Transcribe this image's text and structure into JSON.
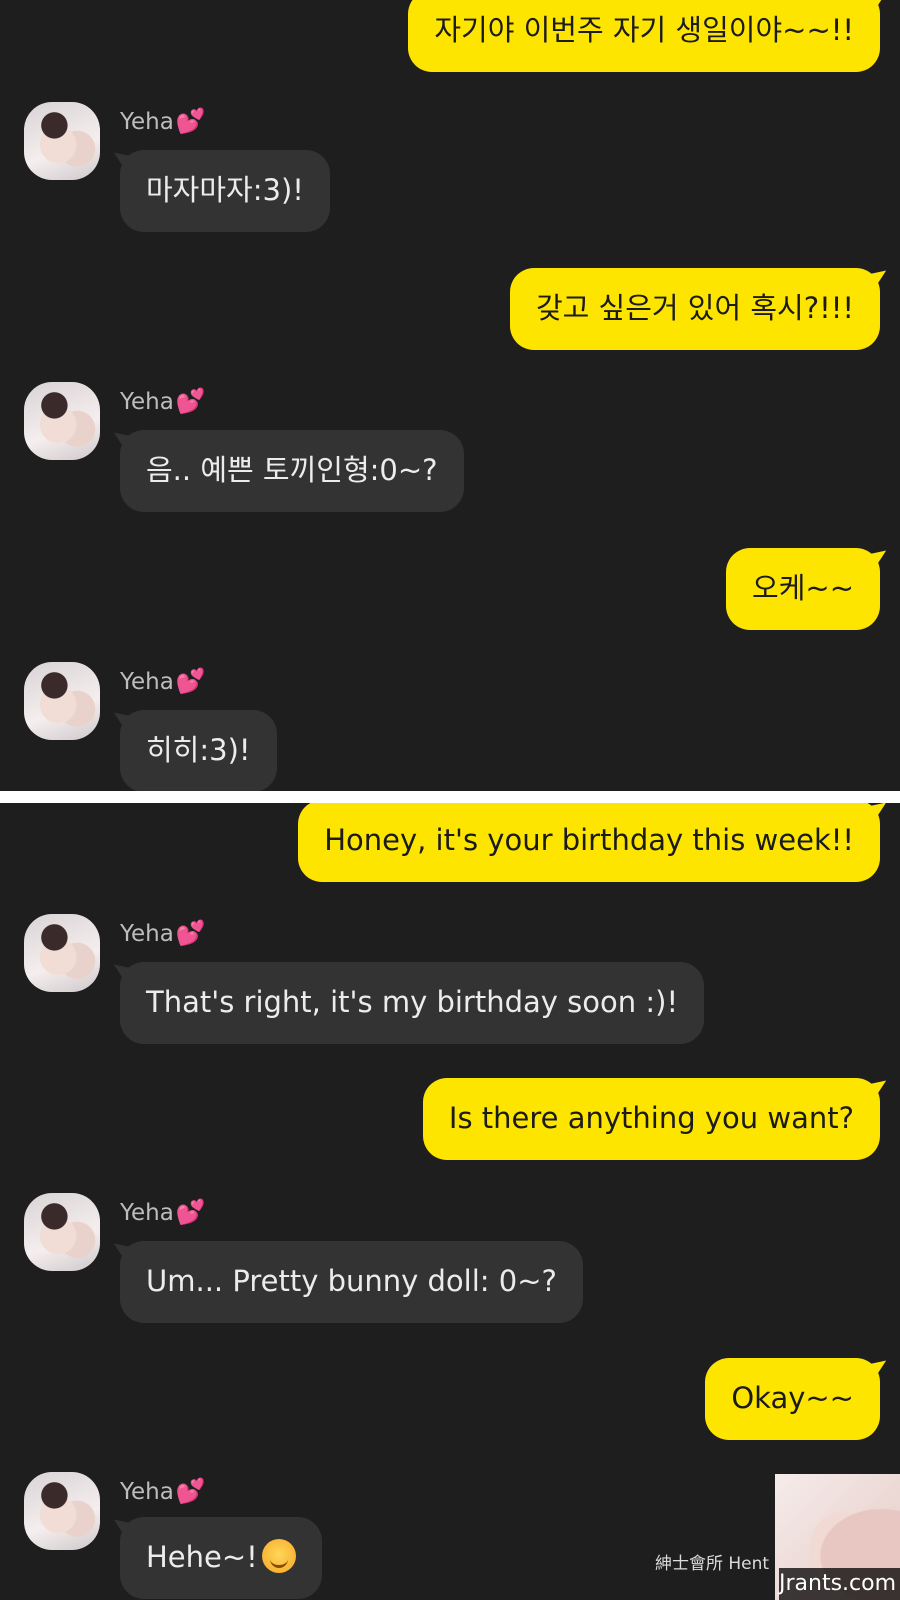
{
  "top_panel": {
    "messages": [
      {
        "side": "me",
        "text": "자기야 이번주 자기 생일이야~~!!"
      },
      {
        "side": "them",
        "sender": "Yeha",
        "text": "마자마자:3)!"
      },
      {
        "side": "me",
        "text": "갖고 싶은거 있어 혹시?!!!"
      },
      {
        "side": "them",
        "sender": "Yeha",
        "text": "음.. 예쁜 토끼인형:0~?"
      },
      {
        "side": "me",
        "text": "오케~~"
      },
      {
        "side": "them",
        "sender": "Yeha",
        "text": "히히:3)!"
      }
    ]
  },
  "bottom_panel": {
    "messages": [
      {
        "side": "me",
        "text": "Honey, it's your birthday this week!!"
      },
      {
        "side": "them",
        "sender": "Yeha",
        "text": "That's right, it's my birthday soon :)!"
      },
      {
        "side": "me",
        "text": "Is there anything you want?"
      },
      {
        "side": "them",
        "sender": "Yeha",
        "text": "Um... Pretty bunny doll: 0~?"
      },
      {
        "side": "me",
        "text": "Okay~~"
      },
      {
        "side": "them",
        "sender": "Yeha",
        "text": "Hehe~!"
      }
    ]
  },
  "sender_emoji": "heart-icon",
  "watermark": {
    "text": "紳士會所 Hent",
    "site": "Jrants.com"
  },
  "colors": {
    "background": "#1e1e1e",
    "my_bubble": "#fee500",
    "their_bubble": "#333334",
    "sender_text": "#bdbdbd"
  }
}
